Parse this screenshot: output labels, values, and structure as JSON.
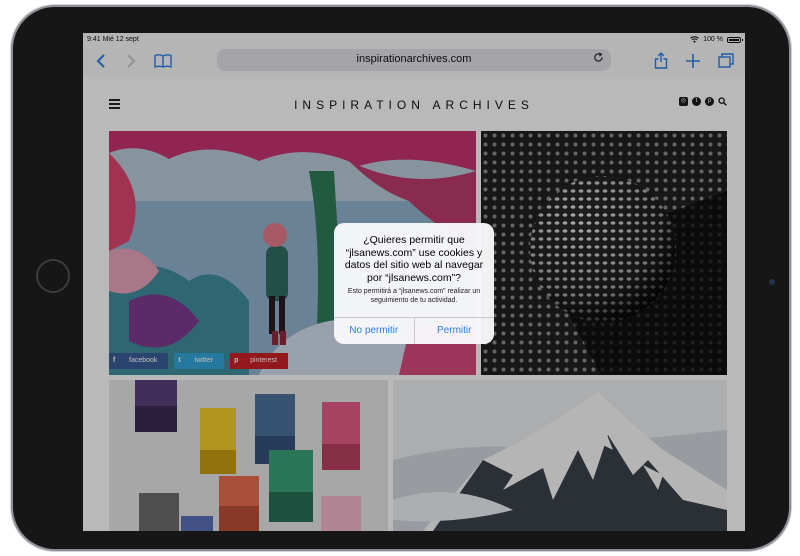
{
  "status": {
    "time": "9:41",
    "date": "Mié 12 sept",
    "wifi_icon": "wifi-icon",
    "battery_label": "100 %",
    "battery_level": 1.0
  },
  "toolbar": {
    "back_icon": "chevron-left-icon",
    "forward_icon": "chevron-right-icon",
    "bookmarks_icon": "book-icon",
    "url": "inspirationarchives.com",
    "reload_icon": "reload-icon",
    "share_icon": "share-icon",
    "new_tab_icon": "plus-icon",
    "tabs_icon": "tabs-icon",
    "accent_color": "#2a7ee6"
  },
  "site": {
    "title": "INSPIRATION ARCHIVES",
    "menu_icon": "hamburger-icon",
    "social": [
      "instagram-icon",
      "twitter-icon",
      "pinterest-icon",
      "search-icon"
    ],
    "share": {
      "facebook": "facebook",
      "twitter": "twitter",
      "pinterest": "pinterest"
    },
    "colors": {
      "facebook": "#3b5b96",
      "twitter": "#33a4d7",
      "pinterest": "#c52125"
    }
  },
  "dialog": {
    "title": "¿Quieres permitir que “jlsanews.com” use cookies y datos del sitio web al navegar por “jlsanews.com”?",
    "message": "Esto permitirá a “jlsanews.com” realizar un seguimiento de tu actividad.",
    "deny_label": "No permitir",
    "allow_label": "Permitir"
  }
}
